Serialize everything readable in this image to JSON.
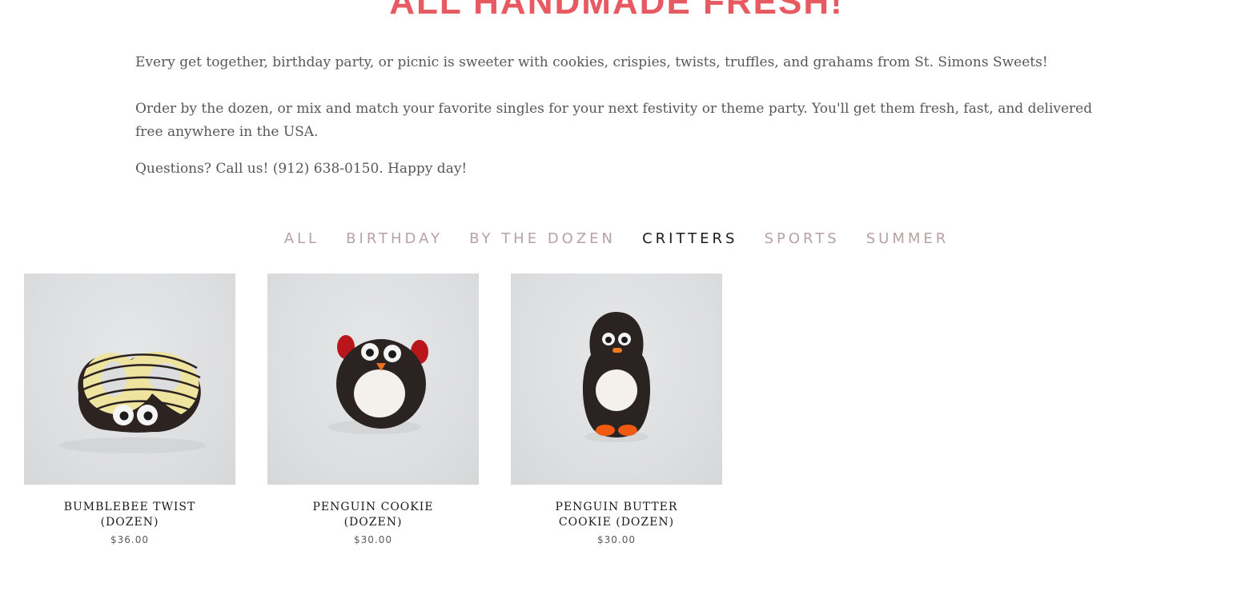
{
  "page": {
    "title": "ALL HANDMADE FRESH!"
  },
  "intro": {
    "p1": "Every get together, birthday party, or picnic is sweeter with cookies, crispies, twists, truffles, and grahams from St. Simons Sweets!",
    "p2": "Order by the dozen, or mix and match your favorite singles for your next festivity or theme party. You'll get them fresh, fast, and delivered free anywhere in the USA.",
    "p3": "Questions? Call us! (912) 638-0150. Happy day!"
  },
  "filters": {
    "active": "CRITTERS",
    "items": [
      {
        "label": "ALL"
      },
      {
        "label": "BIRTHDAY"
      },
      {
        "label": "BY THE DOZEN"
      },
      {
        "label": "CRITTERS"
      },
      {
        "label": "SPORTS"
      },
      {
        "label": "SUMMER"
      }
    ]
  },
  "products": [
    {
      "title": "BUMBLEBEE TWIST (DOZEN)",
      "price": "$36.00",
      "image": "bumblebee-twist-image"
    },
    {
      "title": "PENGUIN COOKIE (DOZEN)",
      "price": "$30.00",
      "image": "penguin-cookie-image"
    },
    {
      "title": "PENGUIN BUTTER COOKIE (DOZEN)",
      "price": "$30.00",
      "image": "penguin-butter-cookie-image"
    }
  ],
  "colors": {
    "title_red": "#e85a62",
    "body_text": "#5b5756",
    "filter_inactive": "#b6a2a4",
    "filter_active": "#1b1b1b",
    "photo_bg": "#dcdddf"
  }
}
